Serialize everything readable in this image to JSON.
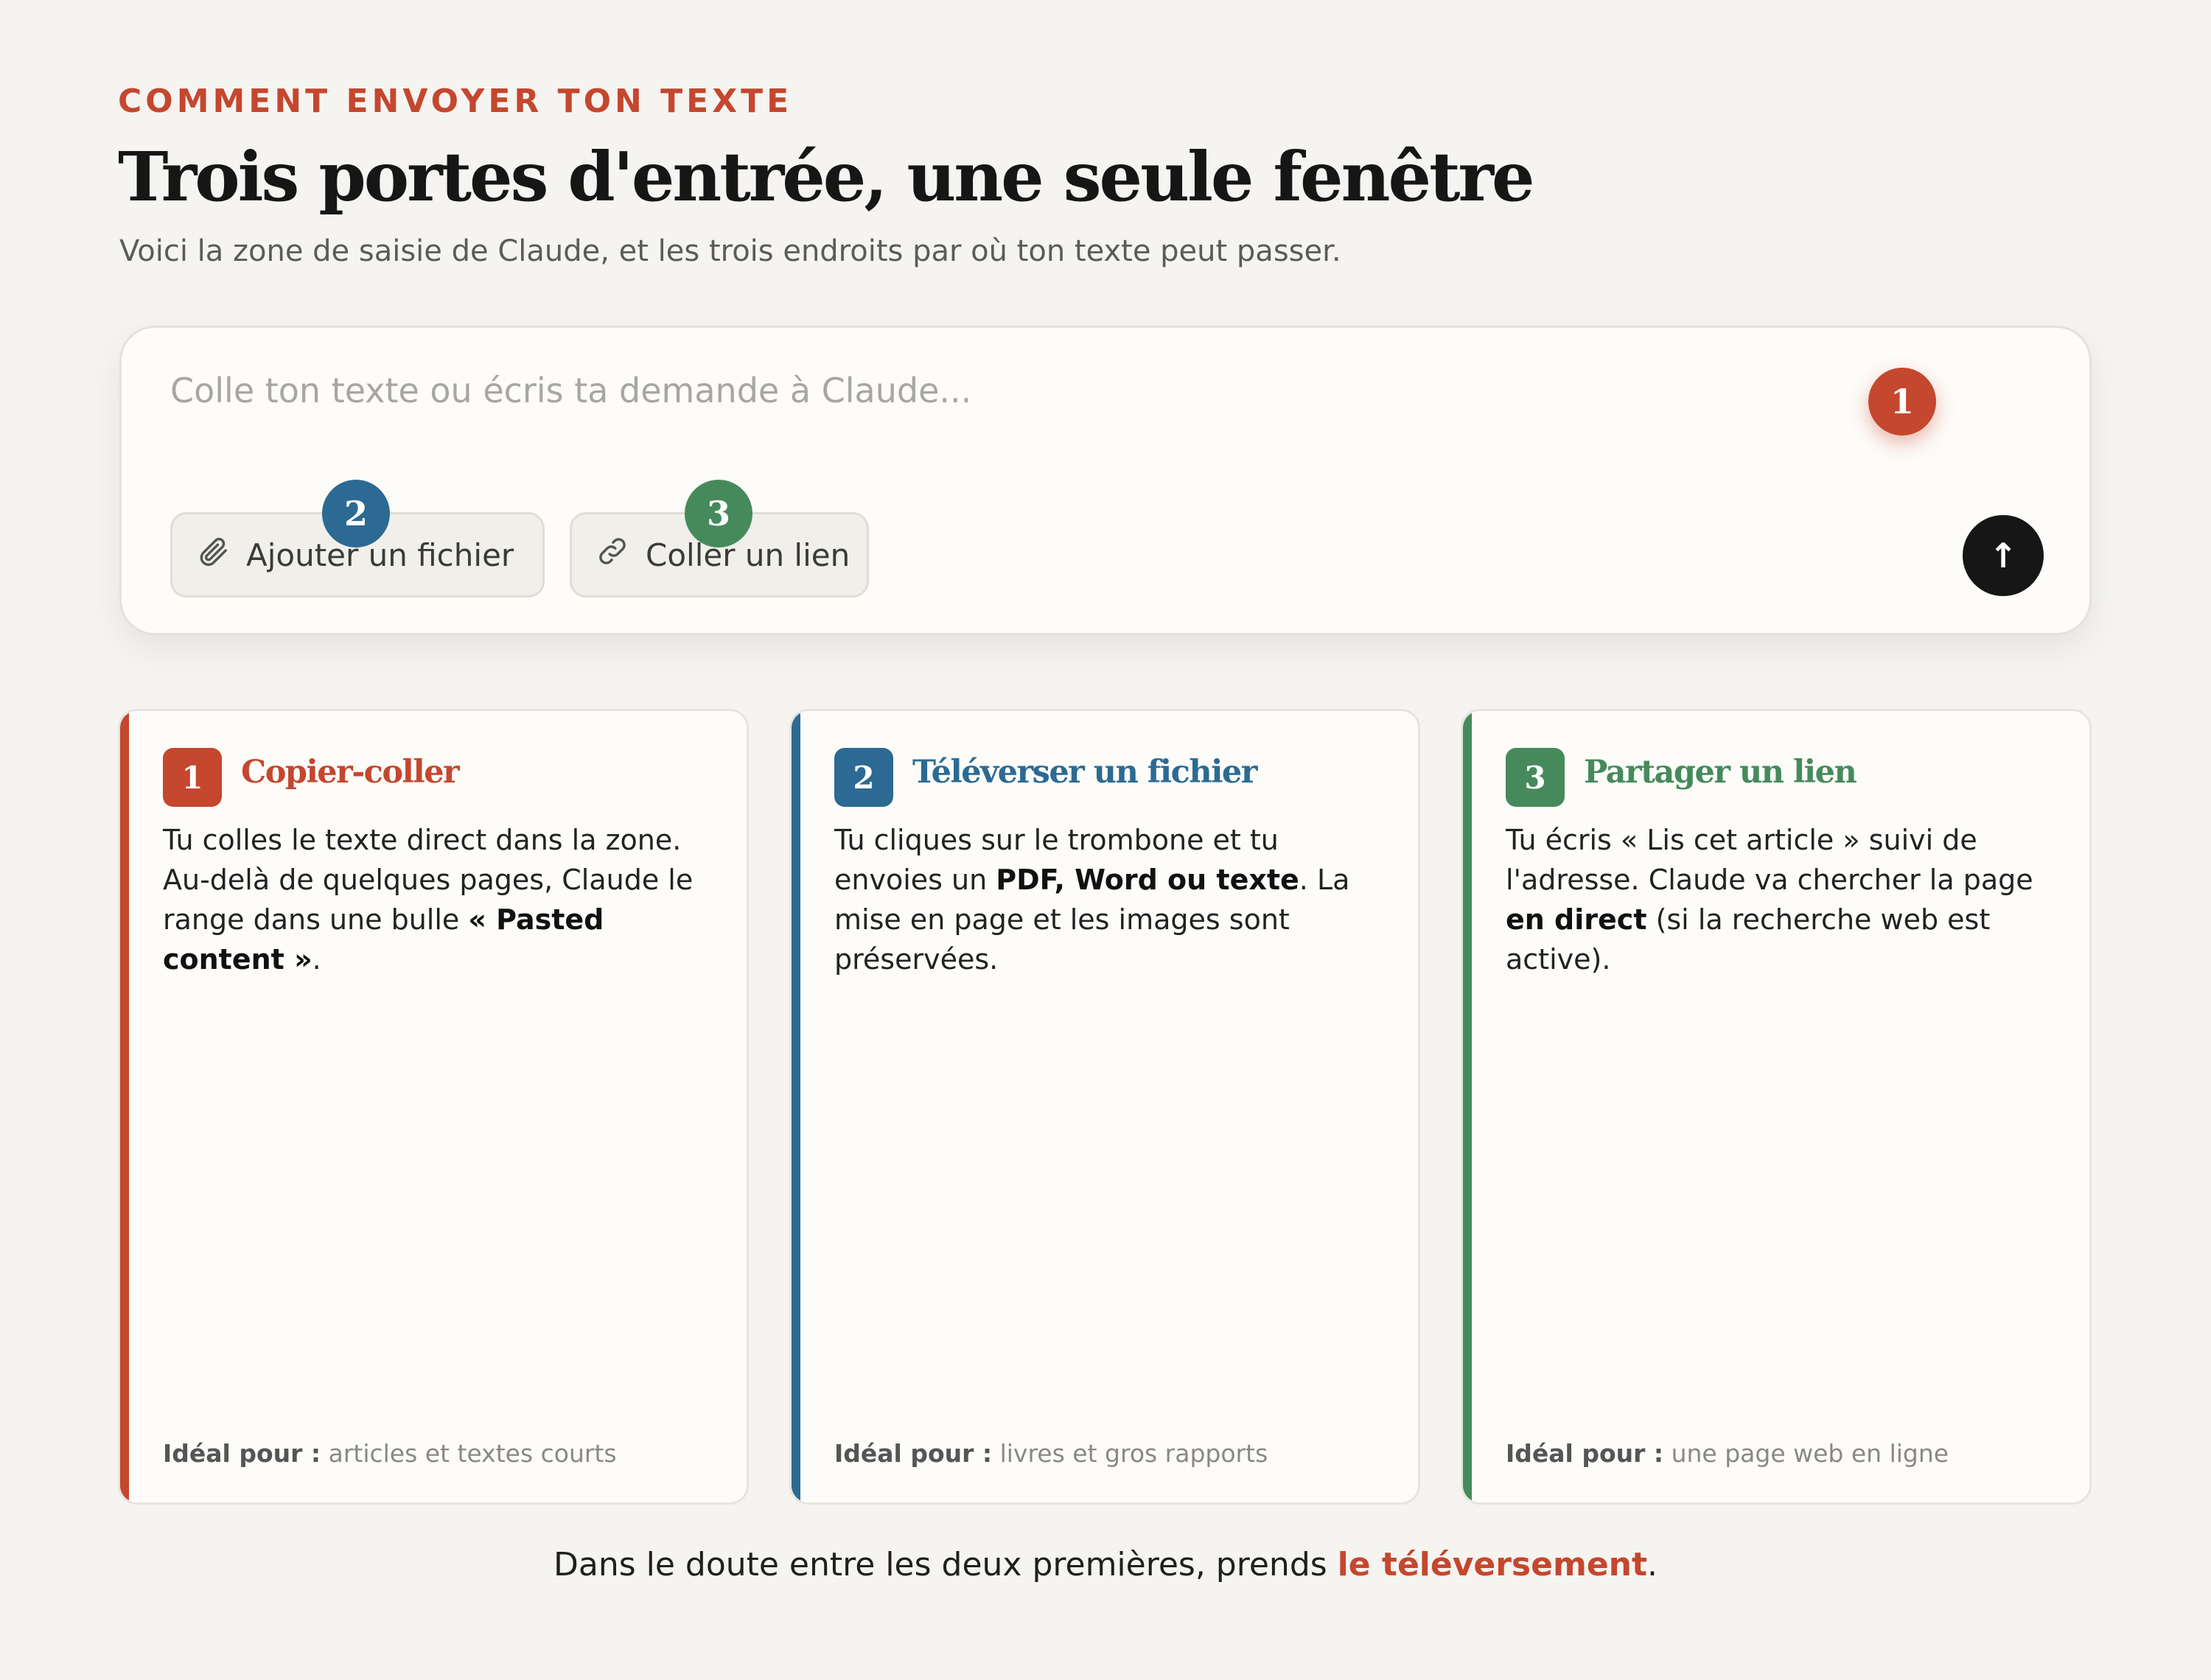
{
  "header": {
    "eyebrow": "COMMENT ENVOYER TON TEXTE",
    "title": "Trois portes d'entrée, une seule fenêtre",
    "subtitle": "Voici la zone de saisie de Claude, et les trois endroits par où ton texte peut passer."
  },
  "composer": {
    "placeholder": "Colle ton texte ou écris ta demande à Claude...",
    "badges": [
      "1",
      "2",
      "3"
    ],
    "attach_label": "Ajouter un fichier",
    "attach_icon": "paperclip-icon",
    "link_label": "Coller un lien",
    "link_icon": "link-icon",
    "send_icon": "arrow-up-icon",
    "send_glyph": "↑"
  },
  "colors": {
    "red": "#c4472e",
    "blue": "#2c6a93",
    "green": "#468a5c"
  },
  "cards": [
    {
      "num": "1",
      "title": "Copier-coller",
      "body_a": "Tu colles le texte direct dans la zone. Au-delà de quelques pages, Claude le range dans une bulle ",
      "body_b": "« Pasted content »",
      "body_c": ".",
      "foot_label": "Idéal pour :",
      "foot_value": " articles et textes courts"
    },
    {
      "num": "2",
      "title": "Téléverser un fichier",
      "body_a": "Tu cliques sur le trombone et tu envoies un ",
      "body_b": "PDF, Word ou texte",
      "body_c": ". La mise en page et les images sont préservées.",
      "foot_label": "Idéal pour :",
      "foot_value": " livres et gros rapports"
    },
    {
      "num": "3",
      "title": "Partager un lien",
      "body_a": "Tu écris « Lis cet article » suivi de l'adresse. Claude va chercher la page ",
      "body_b": "en direct",
      "body_c": " (si la recherche web est active).",
      "foot_label": "Idéal pour :",
      "foot_value": " une page web en ligne"
    }
  ],
  "footer": {
    "text_before": "Dans le doute entre les deux premières, prends ",
    "highlight": "le téléversement",
    "text_after": "."
  }
}
